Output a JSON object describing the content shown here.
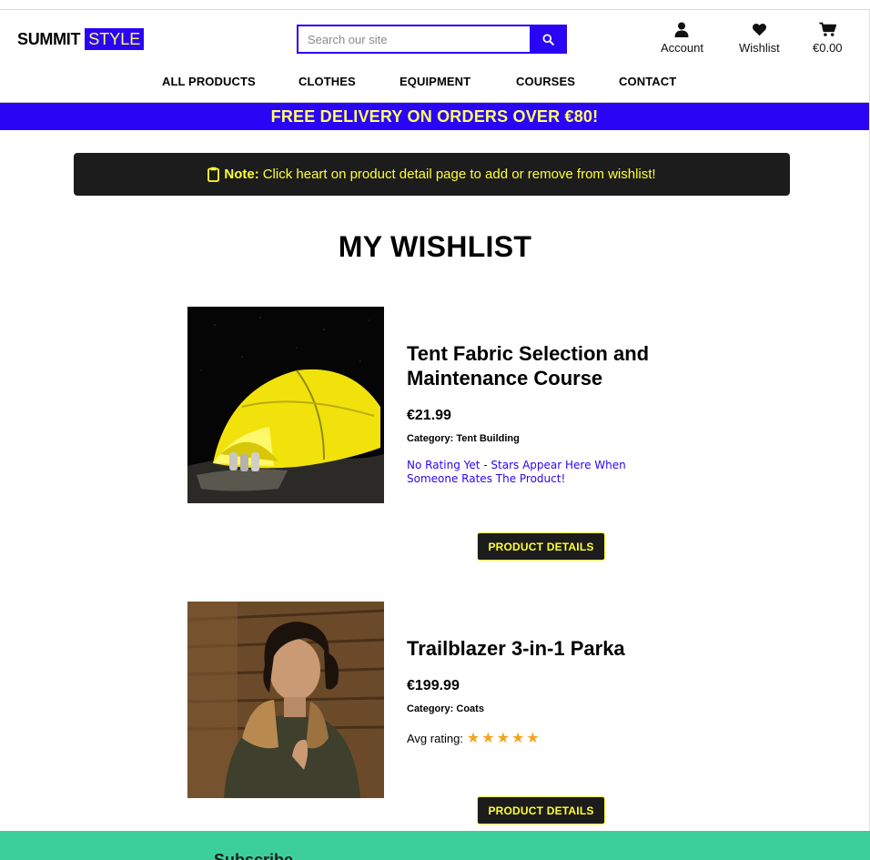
{
  "header": {
    "logo_part1": "SUMMIT",
    "logo_part2": "STYLE",
    "search_placeholder": "Search our site",
    "search_icon": "search-icon",
    "account_label": "Account",
    "wishlist_label": "Wishlist",
    "cart_total": "€0.00"
  },
  "nav": {
    "items": [
      "ALL PRODUCTS",
      "CLOTHES",
      "EQUIPMENT",
      "COURSES",
      "CONTACT"
    ]
  },
  "banner": {
    "text": "FREE DELIVERY ON ORDERS OVER €80!"
  },
  "note": {
    "icon": "clipboard-icon",
    "label": "Note:",
    "text": "Click heart on product detail page to add or remove from wishlist!"
  },
  "page": {
    "title": "MY WISHLIST"
  },
  "products": [
    {
      "title": "Tent Fabric Selection and Maintenance Course",
      "price": "€21.99",
      "category": "Category: Tent Building",
      "rating_text": "No Rating Yet - Stars Appear Here When Someone Rates The Product!",
      "button": "PRODUCT DETAILS"
    },
    {
      "title": "Trailblazer 3-in-1 Parka",
      "price": "€199.99",
      "category": "Category: Coats",
      "rating_label": "Avg rating:",
      "rating_stars": 5,
      "button": "PRODUCT DETAILS"
    }
  ],
  "footer": {
    "subscribe_partial": "Subscribe"
  },
  "colors": {
    "brand": "#2a05f5",
    "accent": "#ffff33",
    "dark": "#1c1c1c",
    "footer": "#3ccf9b",
    "star": "#f7a21b"
  }
}
